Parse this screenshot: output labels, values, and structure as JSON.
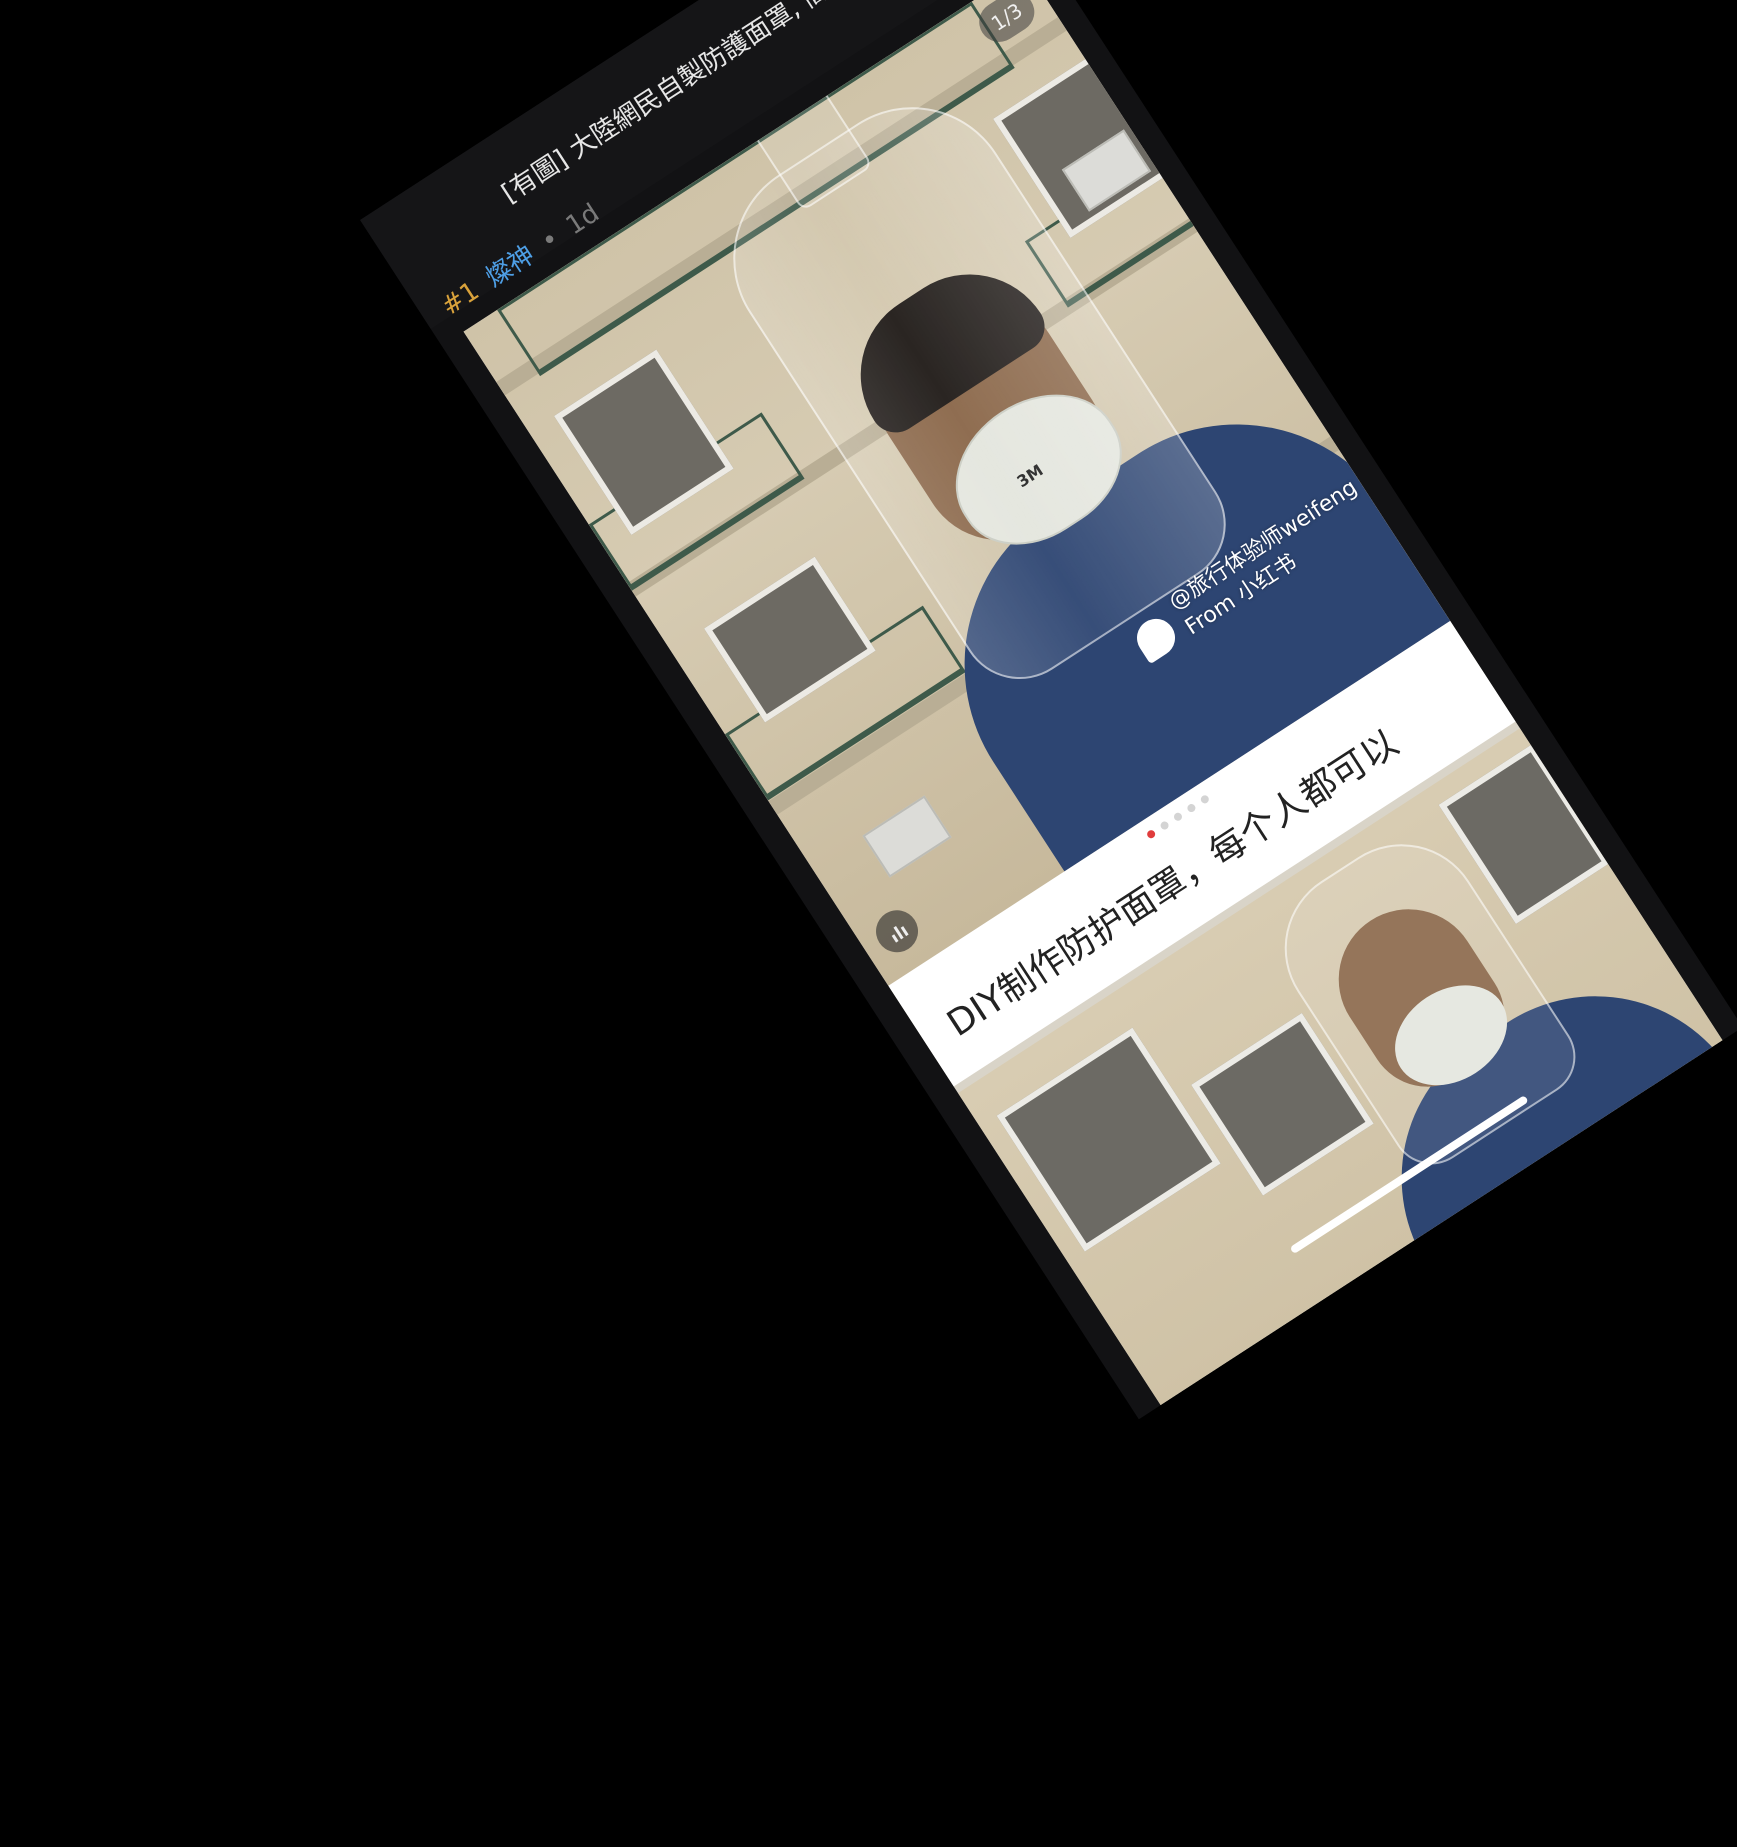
{
  "thread": {
    "title": "[有圖] 大陸網民自製防護面罩, 簡易高效!"
  },
  "post": {
    "floor": "#1",
    "author": "燦神",
    "separator": "•",
    "time": "1d"
  },
  "gallery": {
    "page_counter": "1/3",
    "watermark_line1": "@旅行体验师weifeng",
    "watermark_line2": "From 小红书",
    "mask_brand": "3M",
    "caption": "DIY制作防护面罩，每个人都可以",
    "dots_total": 5,
    "dots_active": 0
  },
  "icons": {
    "more": "more-dots-icon",
    "stats": "stats-icon",
    "watermark_logo": "xiaohongshu-logo-icon"
  },
  "colors": {
    "background": "#000000",
    "app_bg": "#121214",
    "floor": "#d9a23b",
    "author": "#4e9fe6",
    "meta_gray": "#7a7a7a",
    "active_dot": "#e03c3c",
    "shirt": "#2d4572"
  }
}
